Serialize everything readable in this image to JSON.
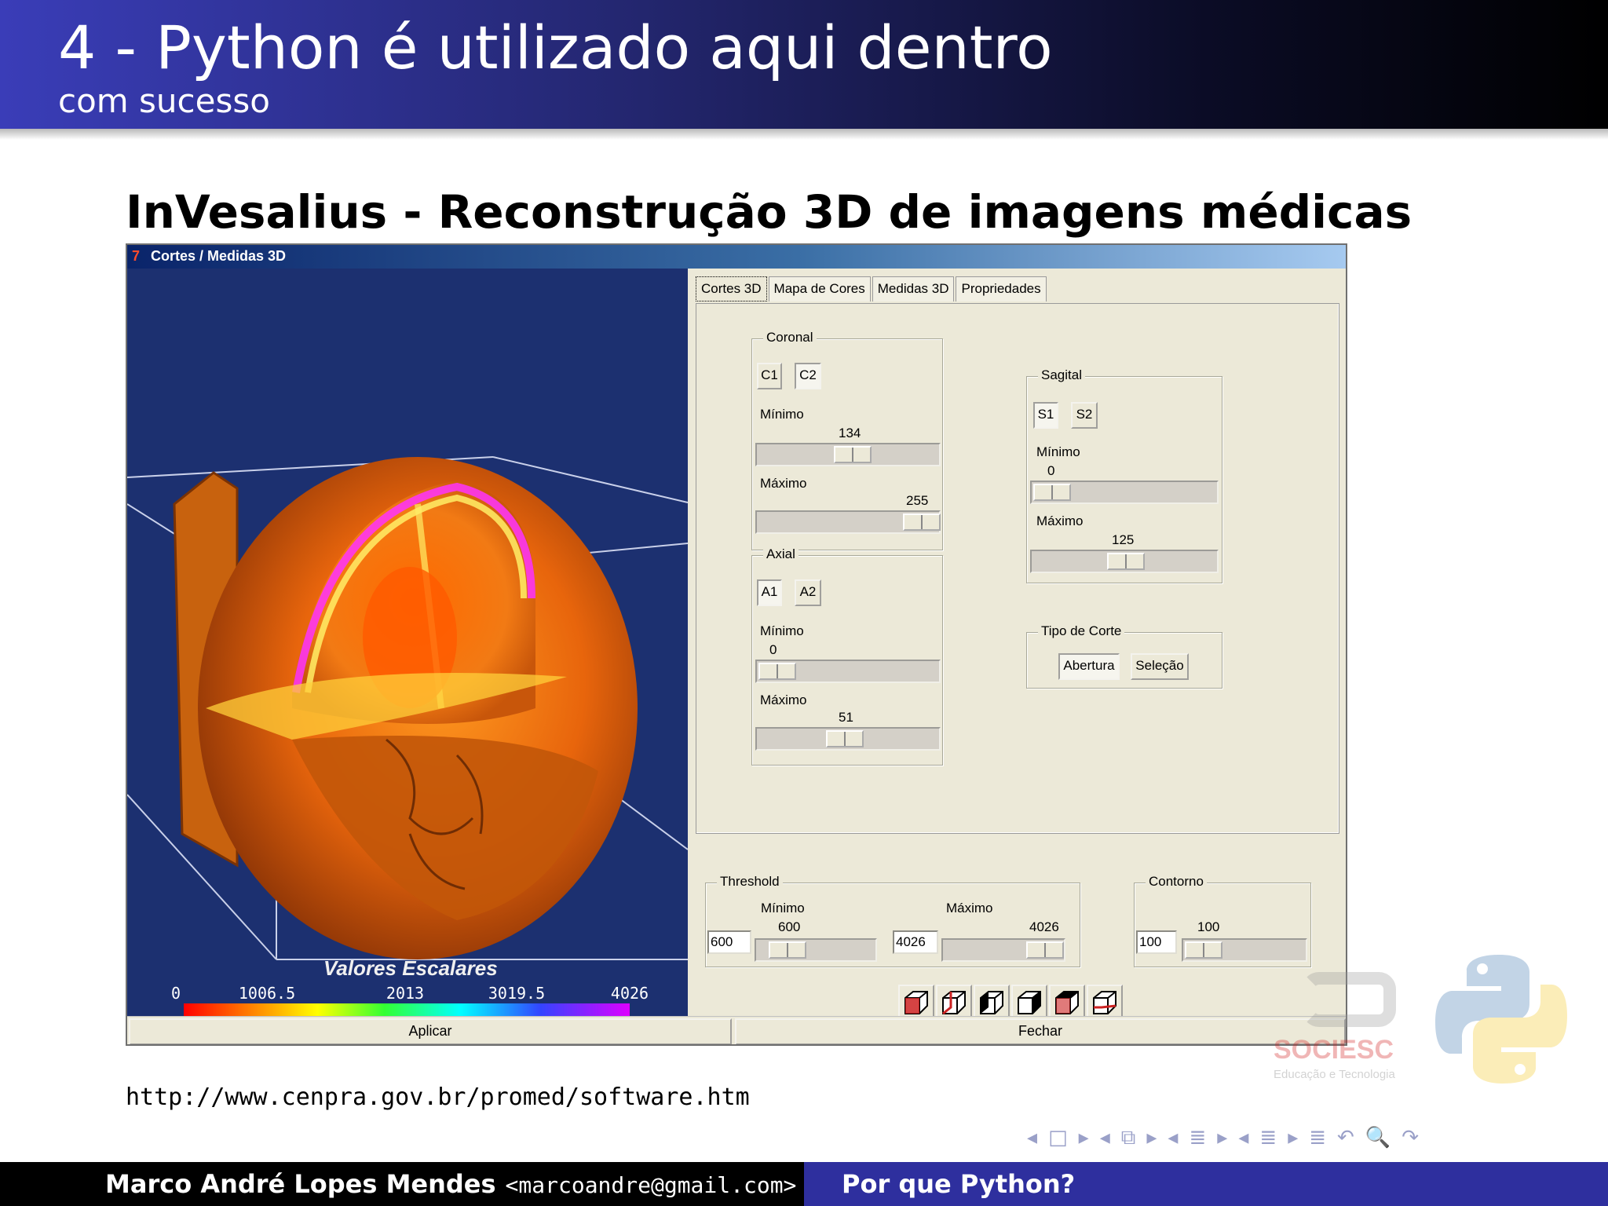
{
  "slide": {
    "title": "4 - Python é utilizado aqui dentro",
    "subtitle": "com sucesso",
    "frame_title": "InVesalius - Reconstrução 3D de imagens médicas",
    "url": "http://www.cenpra.gov.br/promed/software.htm"
  },
  "window": {
    "title": "Cortes / Medidas 3D",
    "logo_text": "7"
  },
  "viewport": {
    "scalar_label": "Valores Escalares",
    "colorbar_ticks": [
      "0",
      "1006.5",
      "2013",
      "3019.5",
      "4026"
    ]
  },
  "tabs": [
    "Cortes 3D",
    "Mapa de Cores",
    "Medidas 3D",
    "Propriedades"
  ],
  "coronal": {
    "label": "Coronal",
    "buttons": [
      "C1",
      "C2"
    ],
    "min_label": "Mínimo",
    "min_value": "134",
    "max_label": "Máximo",
    "max_value": "255"
  },
  "axial": {
    "label": "Axial",
    "buttons": [
      "A1",
      "A2"
    ],
    "min_label": "Mínimo",
    "min_value": "0",
    "max_label": "Máximo",
    "max_value": "51"
  },
  "sagital": {
    "label": "Sagital",
    "buttons": [
      "S1",
      "S2"
    ],
    "min_label": "Mínimo",
    "min_value": "0",
    "max_label": "Máximo",
    "max_value": "125"
  },
  "tipo_corte": {
    "label": "Tipo de Corte",
    "buttons": [
      "Abertura",
      "Seleção"
    ]
  },
  "threshold": {
    "label": "Threshold",
    "min_label": "Mínimo",
    "min_value": "600",
    "min_field": "600",
    "max_label": "Máximo",
    "max_value": "4026",
    "max_field": "4026"
  },
  "contorno": {
    "label": "Contorno",
    "value": "100",
    "field": "100"
  },
  "view_buttons": [
    "view-front-icon",
    "view-back-icon",
    "view-left-icon",
    "view-right-icon",
    "view-top-icon",
    "view-bottom-icon"
  ],
  "bottom_buttons": {
    "apply": "Aplicar",
    "close": "Fechar"
  },
  "logos": {
    "soc_name": "SOCIESC",
    "soc_tagline": "Educação e Tecnologia"
  },
  "nav_symbols": [
    "◂",
    "□",
    "▸",
    "◂",
    "⧉",
    "▸",
    "◂",
    "≣",
    "▸",
    "◂",
    "≣",
    "▸",
    "≣",
    "↶",
    "🔍",
    "↷"
  ],
  "footer": {
    "author": "Marco André Lopes Mendes",
    "email": "<marcoandre@gmail.com>",
    "section": "Por que Python?"
  }
}
